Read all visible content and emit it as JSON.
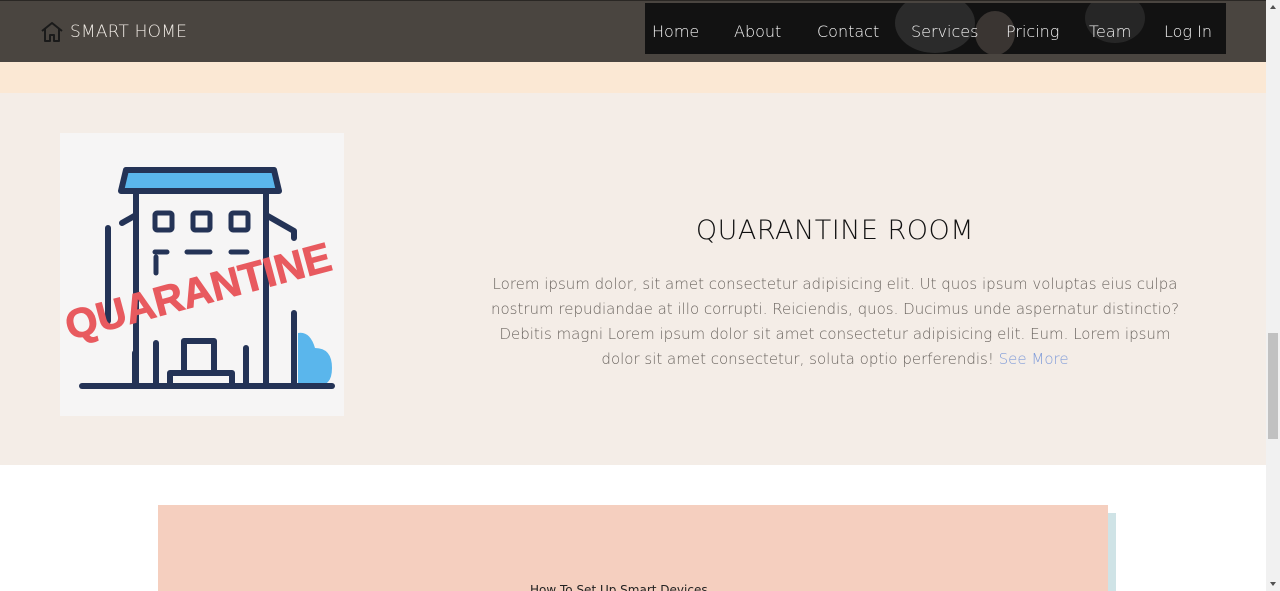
{
  "header": {
    "brand": "SMART HOME",
    "brand_icon": "home-icon",
    "nav": [
      {
        "label": "Home"
      },
      {
        "label": "About"
      },
      {
        "label": "Contact"
      },
      {
        "label": "Services"
      },
      {
        "label": "Pricing"
      },
      {
        "label": "Team"
      },
      {
        "label": "Log In"
      }
    ]
  },
  "feature": {
    "image_text": "QUARANTINE",
    "title": "QUARANTINE ROOM",
    "body": "Lorem ipsum dolor, sit amet consectetur adipisicing elit. Ut quos ipsum voluptas eius culpa nostrum repudiandae at illo corrupti. Reiciendis, quos. Ducimus unde aspernatur distinctio? Debitis magni Lorem ipsum dolor sit amet consectetur adipisicing elit. Eum. Lorem ipsum dolor sit amet consectetur, soluta optio perferendis!",
    "link": "See More"
  },
  "card": {
    "title": "How To Set Up Smart Devices"
  },
  "colors": {
    "header_bg": "#4a4540",
    "cream": "#fbe8d4",
    "section_bg": "#f4ede7",
    "link": "#7f9bd9",
    "card_bg": "#f5cfbf",
    "stamp_red": "#e85a5f",
    "building_navy": "#243356",
    "accent_blue": "#5ab6ec"
  }
}
